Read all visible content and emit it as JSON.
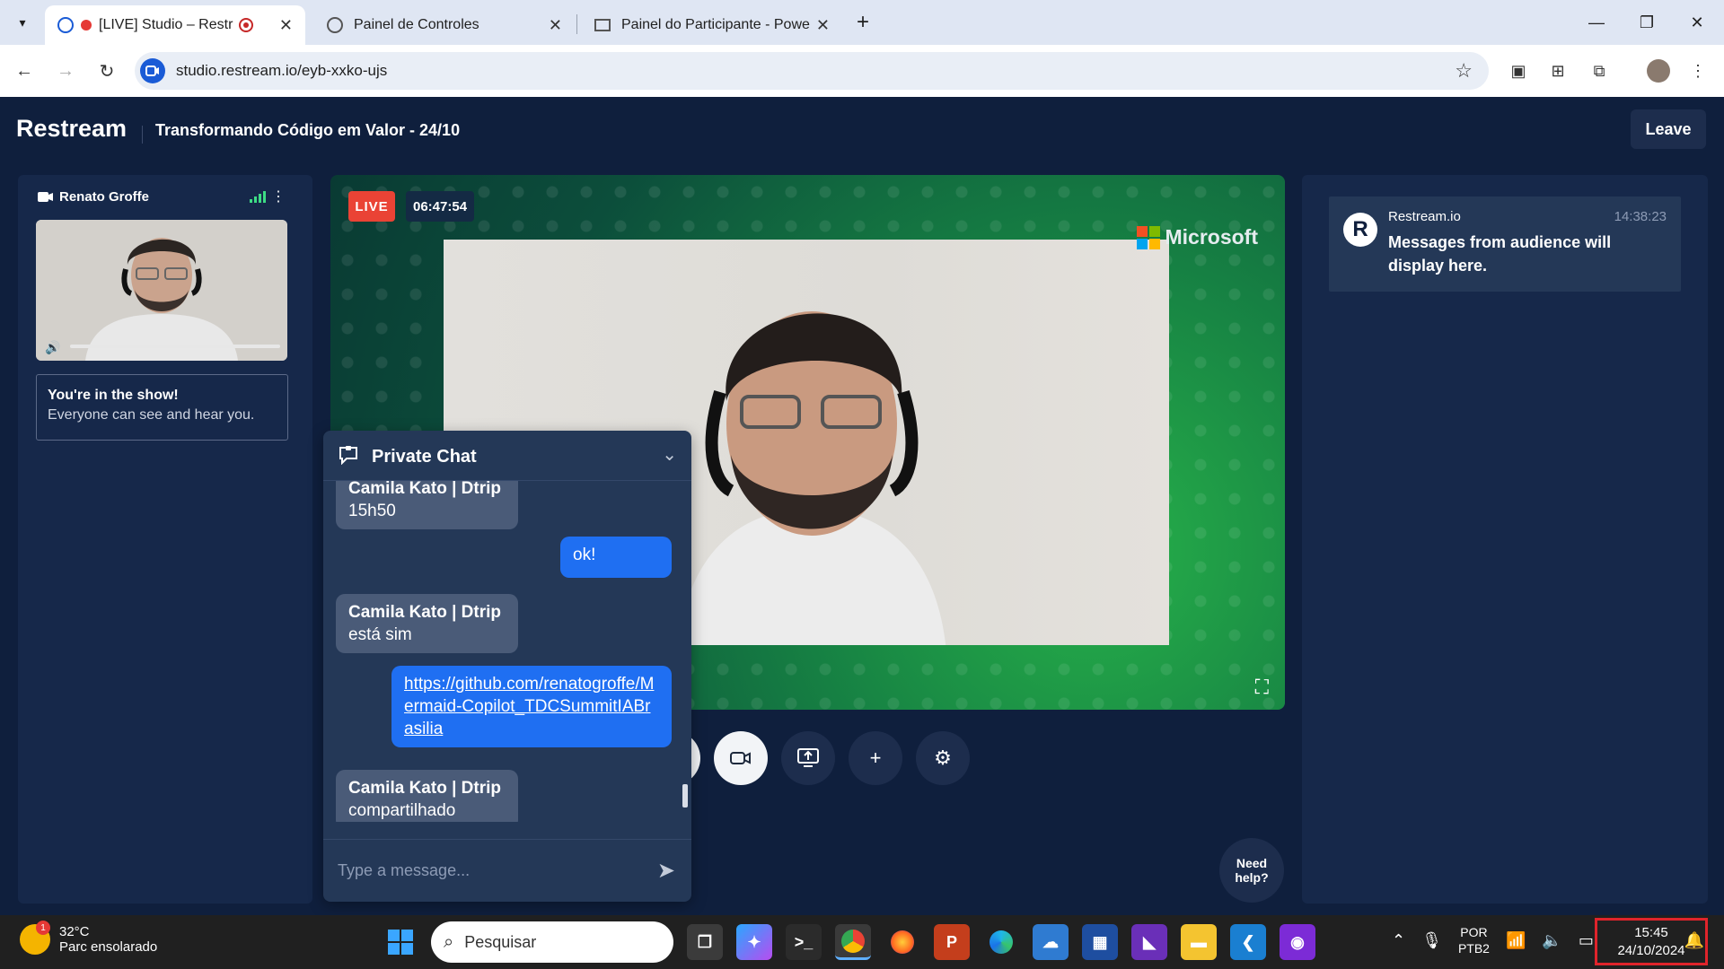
{
  "browser": {
    "tabs": [
      {
        "title": "[LIVE] Studio – Restream",
        "active": true
      },
      {
        "title": "Painel de Controles",
        "active": false
      },
      {
        "title": "Painel do Participante - Powere",
        "active": false
      }
    ],
    "new_tab": "+",
    "url": "studio.restream.io/eyb-xxko-ujs"
  },
  "header": {
    "brand": "Restream",
    "stream_title": "Transformando Código em Valor - 24/10",
    "leave_label": "Leave"
  },
  "participant": {
    "name": "Renato Groffe",
    "signal_level": 4,
    "show_title": "You're in the show!",
    "show_subtitle": "Everyone can see and hear you."
  },
  "stage": {
    "live_badge": "LIVE",
    "timer": "06:47:54",
    "brand_logo_text": "Microsoft"
  },
  "controls": [
    "microphone-icon",
    "camera-icon",
    "share-screen-icon",
    "add-icon",
    "settings-icon"
  ],
  "need_help": "Need help?",
  "audience_chat": {
    "author": "Restream.io",
    "time": "14:38:23",
    "text": "Messages from audience will display here."
  },
  "private_chat": {
    "title": "Private Chat",
    "messages": [
      {
        "author": "Camila Kato | Dtrip",
        "text": "15h50",
        "direction": "in"
      },
      {
        "author": "",
        "text": "ok!",
        "direction": "out"
      },
      {
        "author": "Camila Kato | Dtrip",
        "text": "está sim",
        "direction": "in"
      },
      {
        "author": "",
        "text": "https://github.com/renatogroffe/Mermaid-Copilot_TDCSummitIABrasilia",
        "direction": "out"
      },
      {
        "author": "Camila Kato | Dtrip",
        "text": "compartilhado",
        "direction": "in"
      }
    ],
    "input_placeholder": "Type a message..."
  },
  "taskbar": {
    "weather_temp": "32°C",
    "weather_desc": "Parc ensolarado",
    "weather_badge": "1",
    "search_placeholder": "Pesquisar",
    "lang_line1": "POR",
    "lang_line2": "PTB2",
    "time": "15:45",
    "date": "24/10/2024"
  },
  "colors": {
    "page_bg": "#0f1f3d",
    "panel_bg": "#16284a",
    "live_red": "#ea4335",
    "out_bubble": "#1f6ff2",
    "in_bubble": "#4a5b78",
    "highlight_box": "#e0242b"
  }
}
